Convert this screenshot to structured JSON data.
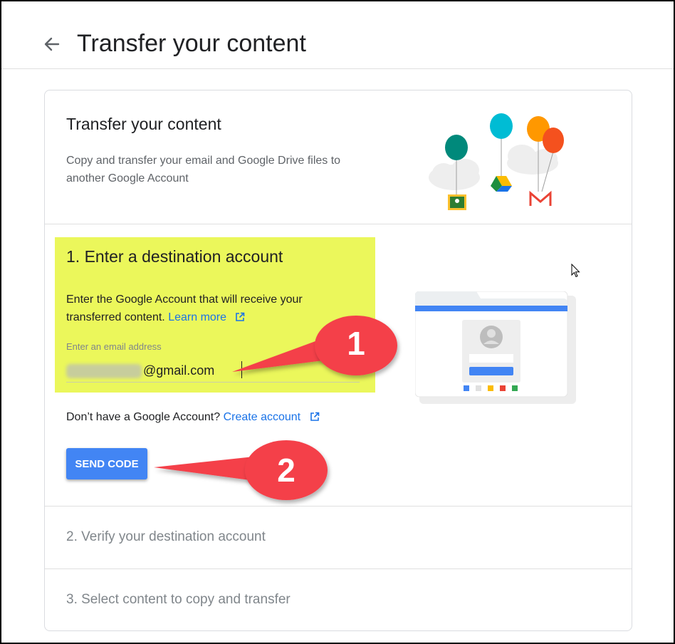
{
  "header": {
    "title": "Transfer your content",
    "back_icon": "arrow-back-icon"
  },
  "intro": {
    "title": "Transfer your content",
    "description": "Copy and transfer your email and Google Drive files to another Google Account",
    "illustration": "balloons-illustration"
  },
  "step1": {
    "title": "1. Enter a destination account",
    "description": "Enter the Google Account that will receive your transferred content.",
    "learn_more": "Learn more",
    "field_label": "Enter an email address",
    "email_value": "@gmail.com",
    "no_account_text": "Don’t have a Google Account?",
    "create_account": "Create account",
    "send_code": "SEND CODE"
  },
  "steps": [
    {
      "label": "2. Verify your destination account"
    },
    {
      "label": "3. Select content to copy and transfer"
    }
  ],
  "annotations": [
    {
      "number": "1"
    },
    {
      "number": "2"
    }
  ],
  "colors": {
    "highlight": "#ebf75b",
    "button": "#4285f4",
    "link": "#1a73e8",
    "callout": "#f4404a"
  }
}
